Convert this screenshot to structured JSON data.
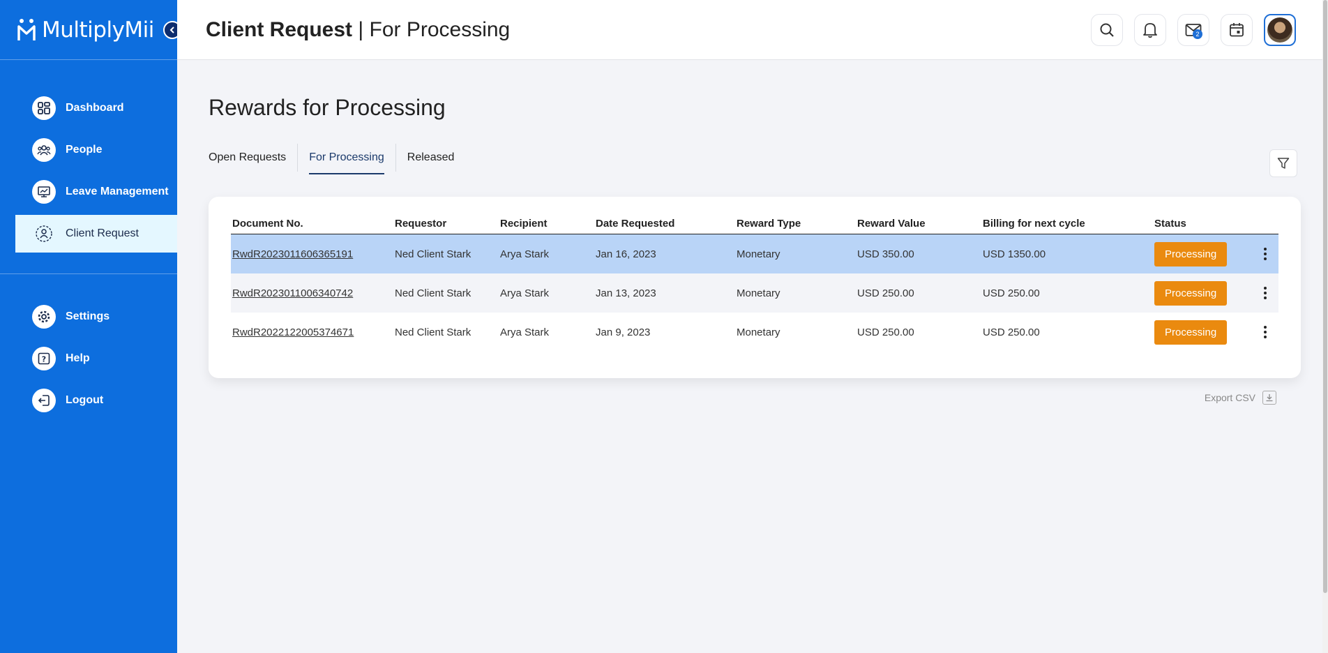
{
  "app": {
    "logo_text": "MultiplyMii"
  },
  "sidebar": {
    "items": [
      {
        "label": "Dashboard",
        "icon": "dashboard-icon"
      },
      {
        "label": "People",
        "icon": "people-icon"
      },
      {
        "label": "Leave Management",
        "icon": "leave-management-icon"
      },
      {
        "label": "Client Request",
        "icon": "client-request-icon",
        "active": true
      }
    ],
    "bottom_items": [
      {
        "label": "Settings",
        "icon": "gear-icon"
      },
      {
        "label": "Help",
        "icon": "help-icon"
      },
      {
        "label": "Logout",
        "icon": "logout-icon"
      }
    ]
  },
  "header": {
    "title_bold": "Client Request",
    "title_sep": " | ",
    "title_rest": "For Processing",
    "mail_badge": "2"
  },
  "main": {
    "heading": "Rewards for Processing",
    "tabs": [
      {
        "label": "Open Requests"
      },
      {
        "label": "For Processing",
        "active": true
      },
      {
        "label": "Released"
      }
    ],
    "table": {
      "columns": [
        "Document No.",
        "Requestor",
        "Recipient",
        "Date Requested",
        "Reward Type",
        "Reward Value",
        "Billing for next cycle",
        "Status"
      ],
      "rows": [
        {
          "doc": "RwdR2023011606365191",
          "requestor": "Ned Client Stark",
          "recipient": "Arya Stark",
          "date": "Jan 16, 2023",
          "type": "Monetary",
          "value": "USD 350.00",
          "billing": "USD 1350.00",
          "status": "Processing"
        },
        {
          "doc": "RwdR2023011006340742",
          "requestor": "Ned Client Stark",
          "recipient": "Arya Stark",
          "date": "Jan 13, 2023",
          "type": "Monetary",
          "value": "USD 250.00",
          "billing": "USD 250.00",
          "status": "Processing"
        },
        {
          "doc": "RwdR2022122005374671",
          "requestor": "Ned Client Stark",
          "recipient": "Arya Stark",
          "date": "Jan 9, 2023",
          "type": "Monetary",
          "value": "USD 250.00",
          "billing": "USD 250.00",
          "status": "Processing"
        }
      ]
    },
    "export_label": "Export CSV"
  },
  "colors": {
    "sidebar": "#0d6ede",
    "status_processing": "#ea8a0f",
    "row_selected": "#b9d4f7"
  }
}
